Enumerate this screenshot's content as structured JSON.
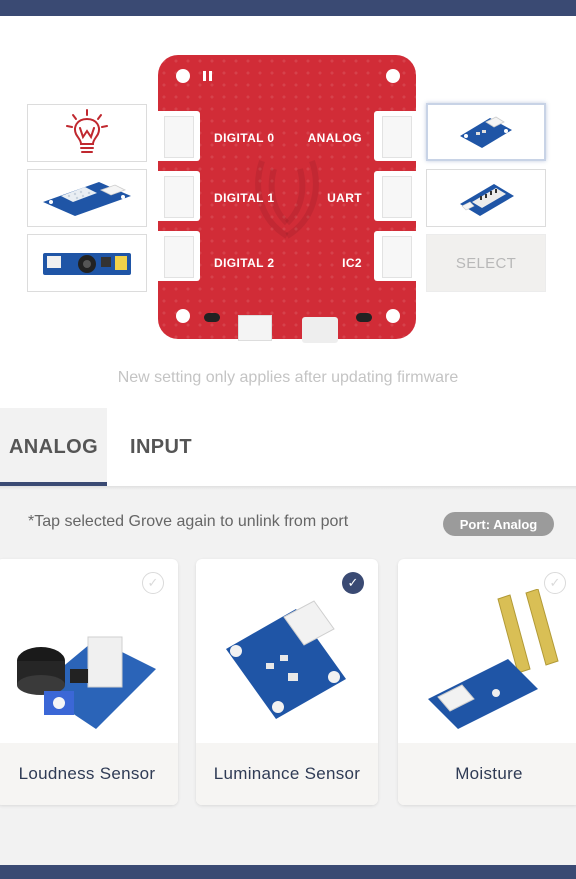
{
  "colors": {
    "navy": "#3a4a73",
    "board_red": "#d12c37",
    "grove_blue": "#1f55a6"
  },
  "board": {
    "ports_left": [
      "DIGITAL 0",
      "DIGITAL 1",
      "DIGITAL 2"
    ],
    "ports_right": [
      "ANALOG",
      "UART",
      "IC2"
    ]
  },
  "left_modules": [
    {
      "icon": "wio-lightbulb-icon"
    },
    {
      "icon": "temperature-humidity-sensor-icon"
    },
    {
      "icon": "loudness-sensor-icon"
    }
  ],
  "right_modules": [
    {
      "icon": "luminance-sensor-icon",
      "active": true
    },
    {
      "icon": "led-bar-icon"
    },
    {
      "select_label": "SELECT"
    }
  ],
  "hint_text": "New setting only applies after updating firmware",
  "tabs": [
    {
      "label": "ANALOG",
      "active": true
    },
    {
      "label": "INPUT",
      "active": false
    }
  ],
  "note_text": "*Tap selected Grove again to unlink from port",
  "port_badge": "Port: Analog",
  "cards": [
    {
      "label": "Loudness Sensor",
      "selected": false
    },
    {
      "label": "Luminance Sensor",
      "selected": true
    },
    {
      "label": "Moisture",
      "selected": false
    }
  ]
}
